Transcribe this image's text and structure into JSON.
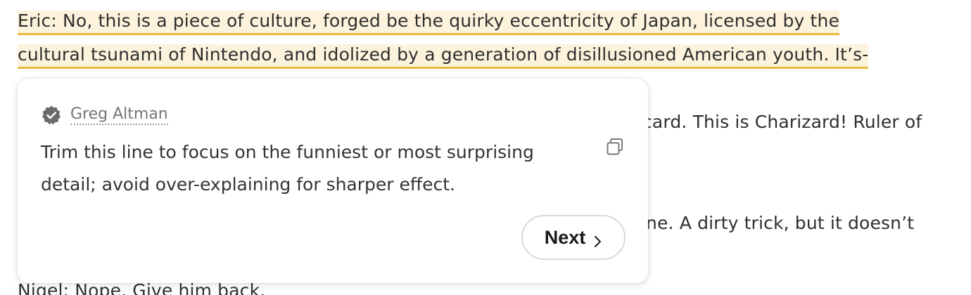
{
  "document": {
    "lines": [
      "Eric: No, this is a piece of culture, forged be the quirky eccentricity of Japan, licensed by the",
      "cultural tsunami of Nintendo, and idolized by a generation of disillusioned American youth. It’s-",
      "card. This is Charizard! Ruler of",
      "ne. A dirty trick, but it doesn’t",
      "Nigel: Nope. Give him back."
    ]
  },
  "comment_popup": {
    "author": "Greg Altman",
    "text": "Trim this line to focus on the funniest or most surprising detail; avoid over-explaining for sharper effect.",
    "next_label": "Next",
    "icons": {
      "author_badge": "verified-badge-icon",
      "copy": "copy-icon",
      "next": "chevron-right-icon"
    }
  },
  "colors": {
    "highlight_fill": "#fdf3dc",
    "highlight_underline": "#e8b93a"
  }
}
